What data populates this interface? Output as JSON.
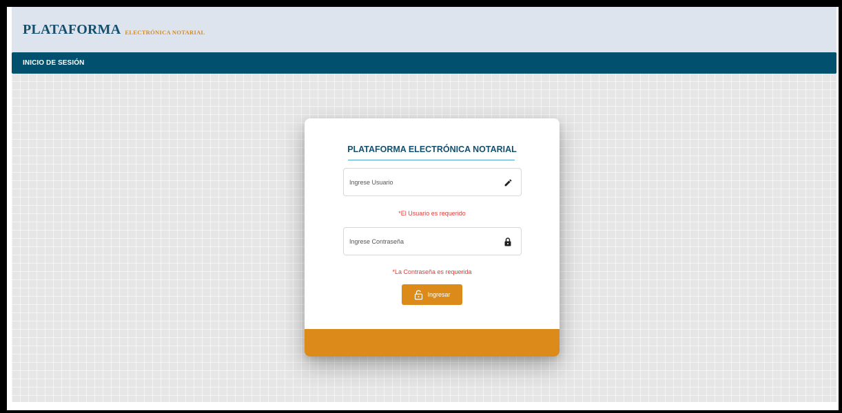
{
  "header": {
    "brand_main": "PLATAFORMA",
    "brand_sub": "ELECTRÓNICA NOTARIAL"
  },
  "nav": {
    "title": "INICIO DE SESIÓN"
  },
  "login": {
    "title": "PLATAFORMA ELECTRÓNICA NOTARIAL",
    "username": {
      "value": "",
      "placeholder": "Ingrese Usuario",
      "icon": "pencil-icon",
      "error": "*El Usuario es requerido"
    },
    "password": {
      "value": "",
      "placeholder": "Ingrese Contraseña",
      "icon": "lock-icon",
      "error": "*La Contraseña es requerida"
    },
    "submit": {
      "label": "Ingresar",
      "icon": "unlock-icon"
    }
  },
  "colors": {
    "brand_primary": "#14506e",
    "brand_accent": "#dc8a1a",
    "nav_bar": "#00506e",
    "header_bg": "#dde4ee",
    "error": "#e53935",
    "underline": "#4aa3d1"
  }
}
